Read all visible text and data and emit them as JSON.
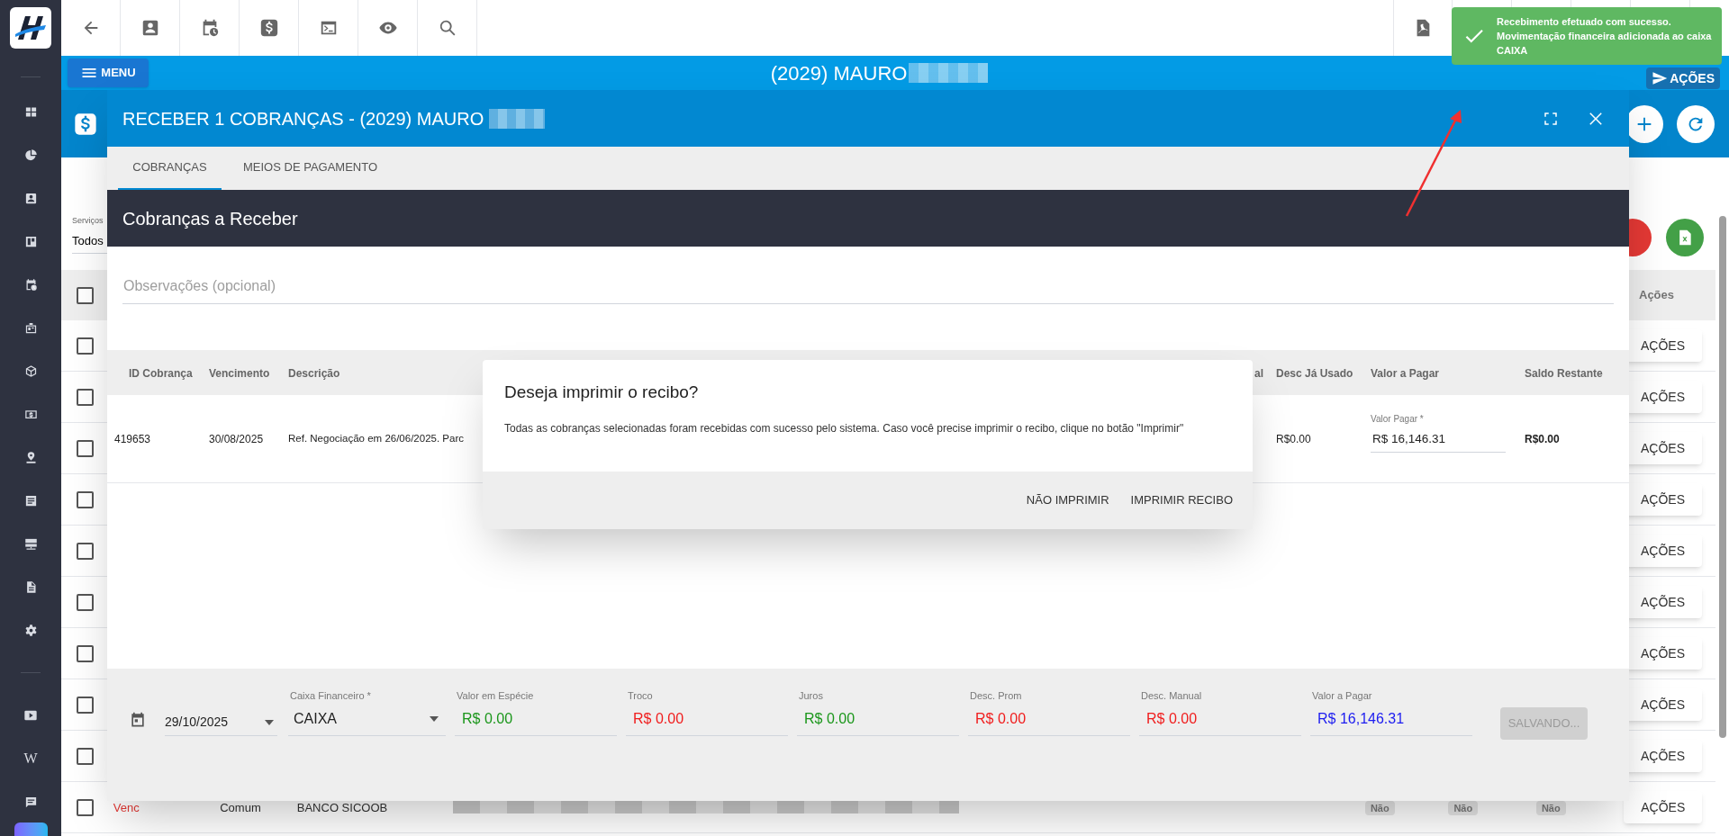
{
  "sidebar": {
    "wiki_glyph": "W"
  },
  "header": {
    "menu_button": "MENU",
    "title": "(2029) MAURO",
    "actions_button": "AÇÕES"
  },
  "notification": {
    "message": "Recebimento efetuado com sucesso. Movimentação financeira adicionada ao caixa CAIXA"
  },
  "background_page": {
    "filter": {
      "label": "Serviços",
      "value": "Todos"
    },
    "actions_header": "Ações",
    "header_checked": false,
    "rows": [
      {
        "checked": false,
        "action": "AÇÕES"
      },
      {
        "checked": false,
        "action": "AÇÕES"
      },
      {
        "checked": false,
        "action": "AÇÕES"
      },
      {
        "checked": false,
        "action": "AÇÕES"
      },
      {
        "checked": false,
        "action": "AÇÕES"
      },
      {
        "checked": false,
        "action": "AÇÕES"
      },
      {
        "checked": false,
        "action": "AÇÕES"
      },
      {
        "checked": false,
        "action": "AÇÕES"
      },
      {
        "checked": false,
        "action": "AÇÕES"
      },
      {
        "checked": false,
        "action": "AÇÕES",
        "status": "Venc",
        "type": "Comum",
        "bank": "BANCO SICOOB",
        "flags": [
          "Não",
          "Não",
          "Não"
        ]
      }
    ]
  },
  "modal": {
    "title": "RECEBER 1 COBRANÇAS - (2029) MAURO",
    "tabs": [
      {
        "label": "COBRANÇAS",
        "selected": true
      },
      {
        "label": "MEIOS DE PAGAMENTO",
        "selected": false
      }
    ],
    "section_title": "Cobranças a Receber",
    "notes": {
      "placeholder": "Observações (opcional)"
    },
    "table": {
      "columns": [
        "ID Cobrança",
        "Vencimento",
        "Descrição",
        "al",
        "Desc Já Usado",
        "Valor a Pagar",
        "Saldo Restante"
      ],
      "rows": [
        {
          "id": "419653",
          "due": "30/08/2025",
          "description": "Ref. Negociação em 26/06/2025. Parc",
          "discount_used": "R$0.00",
          "amount_field": {
            "label": "Valor Pagar *",
            "value": "R$ 16,146.31"
          },
          "balance": "R$0.00"
        }
      ]
    },
    "footer": {
      "date": "29/10/2025",
      "fields": [
        {
          "kind": "select",
          "label": "Caixa Financeiro *",
          "value": "CAIXA"
        },
        {
          "kind": "amount",
          "label": "Valor em Espécie",
          "value": "R$ 0.00",
          "color": "#1a961a"
        },
        {
          "kind": "amount",
          "label": "Troco",
          "value": "R$ 0.00",
          "color": "#f01c1c"
        },
        {
          "kind": "amount",
          "label": "Juros",
          "value": "R$ 0.00",
          "color": "#1a961a"
        },
        {
          "kind": "amount",
          "label": "Desc. Prom",
          "value": "R$ 0.00",
          "color": "#f01c1c"
        },
        {
          "kind": "amount",
          "label": "Desc. Manual",
          "value": "R$ 0.00",
          "color": "#f01c1c"
        },
        {
          "kind": "amount",
          "label": "Valor a Pagar",
          "value": "R$ 16,146.31",
          "color": "#1c1cf0"
        }
      ],
      "save_button": {
        "label": "SALVANDO...",
        "disabled": true
      }
    }
  },
  "dialog": {
    "title": "Deseja imprimir o recibo?",
    "message": "Todas as cobranças selecionadas foram recebidas com sucesso pelo sistema. Caso você precise imprimir o recibo, clique no botão \"Imprimir\"",
    "buttons": [
      "NÃO IMPRIMIR",
      "IMPRIMIR RECIBO"
    ]
  }
}
